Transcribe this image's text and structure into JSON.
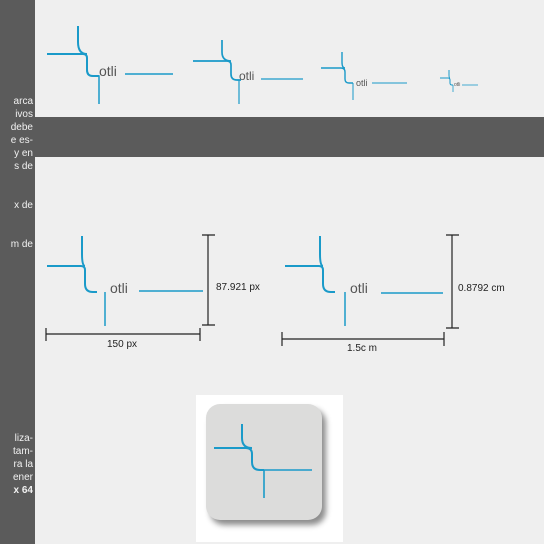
{
  "sidebar": {
    "fragments": [
      "arca",
      "ivos",
      "debe",
      "e es-",
      "y en",
      "s de",
      "x de",
      "m de",
      "liza-",
      "tam-",
      "ra la",
      "ener",
      "x 64"
    ]
  },
  "logo": {
    "wordmark": "otli",
    "color": "#1a9ac9",
    "text_color": "#555555"
  },
  "dimensions": {
    "px": {
      "width": "150 px",
      "height": "87.921 px"
    },
    "cm": {
      "width": "1.5c m",
      "height": "0.8792 cm"
    }
  },
  "icon": {
    "name": "app-icon"
  }
}
